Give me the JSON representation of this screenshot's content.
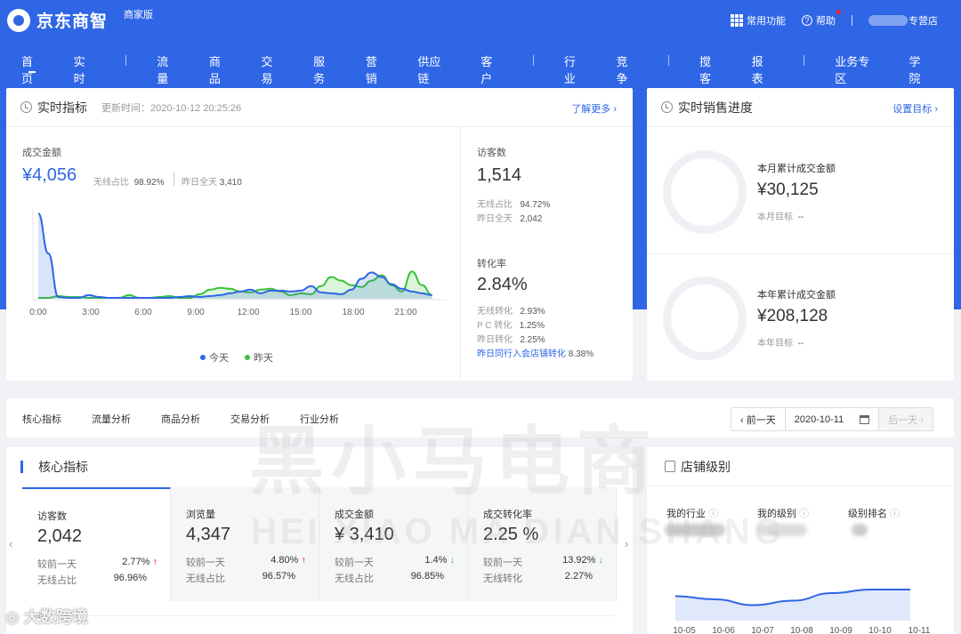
{
  "app": {
    "title": "京东商智",
    "edition": "商家版"
  },
  "topbar": {
    "common_functions": "常用功能",
    "help": "帮助",
    "shop_suffix": "专营店"
  },
  "nav": {
    "tabs": [
      "首页",
      "实时",
      "流量",
      "商品",
      "交易",
      "服务",
      "营销",
      "供应链",
      "客户",
      "行业",
      "竞争",
      "搅客",
      "报表",
      "业务专区",
      "学院"
    ],
    "active": "首页"
  },
  "realtime": {
    "title": "实时指标",
    "update_time": "更新时间：2020-10-12 20:25:26",
    "more_link": "了解更多 ›",
    "gmv_label": "成交金额",
    "gmv_value": "¥4,056",
    "wireless_ratio_label": "无线占比",
    "wireless_ratio": "98.92%",
    "yesterday_label": "昨日全天",
    "yesterday_value": "3,410",
    "visitors_label": "访客数",
    "visitors_value": "1,514",
    "visitors_wireless_label": "无线占比",
    "visitors_wireless": "94.72%",
    "visitors_yesterday_label": "昨日全天",
    "visitors_yesterday": "2,042",
    "conversion_label": "转化率",
    "conversion_value": "2.84%",
    "conv_wireless_label": "无线转化",
    "conv_wireless": "2.93%",
    "conv_pc_label": "P C 转化",
    "conv_pc": "1.25%",
    "conv_yesterday_label": "昨日转化",
    "conv_yesterday": "2.25%",
    "peer_label": "昨日同行入会店铺转化",
    "peer_value": "8.38%",
    "chart_data": {
      "type": "area",
      "x_ticks": [
        "0:00",
        "3:00",
        "6:00",
        "9:00",
        "12:00",
        "15:00",
        "18:00",
        "21:00"
      ],
      "series": [
        {
          "name": "今天",
          "color": "#2f66e6",
          "values": [
            9.4,
            5.0,
            0.2,
            0.1,
            0.1,
            0.4,
            0.2,
            0.1,
            0.1,
            0.1,
            0.1,
            0.1,
            0.1,
            0.1,
            0.2,
            0.3,
            0.2,
            0.3,
            0.4,
            0.6,
            0.8,
            1.0,
            0.6,
            0.9,
            0.9,
            0.8,
            0.9,
            1.4,
            0.7,
            0.6,
            0.5,
            1.0,
            2.2,
            2.9,
            2.4,
            1.6,
            1.1,
            0.8,
            0.6,
            0.4
          ]
        },
        {
          "name": "昨天",
          "color": "#3ac23a",
          "values": [
            0.1,
            0.1,
            0.3,
            0.2,
            0.2,
            0.1,
            0.1,
            0.1,
            0.1,
            0.4,
            0.1,
            0.1,
            0.2,
            0.3,
            0.1,
            0.1,
            0.5,
            1.0,
            1.2,
            1.1,
            0.8,
            0.7,
            1.0,
            1.1,
            0.8,
            0.4,
            0.6,
            0.5,
            1.4,
            2.4,
            2.0,
            1.5,
            1.3,
            2.0,
            2.6,
            1.5,
            0.8,
            3.0,
            1.5,
            0.4
          ]
        }
      ]
    }
  },
  "sales_progress": {
    "title": "实时销售进度",
    "set_target": "设置目标 ›",
    "month_label": "本月累计成交金额",
    "month_value": "¥30,125",
    "month_target_label": "本月目标",
    "month_target": "--",
    "year_label": "本年累计成交金额",
    "year_value": "¥208,128",
    "year_target_label": "本年目标",
    "year_target": "--"
  },
  "subnav": {
    "tabs": [
      "核心指标",
      "流量分析",
      "商品分析",
      "交易分析",
      "行业分析"
    ],
    "prev_day": "‹ 前一天",
    "date": "2020-10-11",
    "next_day": "后一天 ›"
  },
  "core": {
    "title": "核心指标",
    "axis_label": "4k",
    "kpis": [
      {
        "label": "访客数",
        "value": "2,042",
        "cmp_label": "较前一天",
        "cmp_value": "2.77%",
        "trend": "up",
        "sub_label": "无线占比",
        "sub_value": "96.96%"
      },
      {
        "label": "浏览量",
        "value": "4,347",
        "cmp_label": "较前一天",
        "cmp_value": "4.80%",
        "trend": "up",
        "sub_label": "无线占比",
        "sub_value": "96.57%"
      },
      {
        "label": "成交金额",
        "value": "¥ 3,410",
        "cmp_label": "较前一天",
        "cmp_value": "1.4%",
        "trend": "down",
        "sub_label": "无线占比",
        "sub_value": "96.85%"
      },
      {
        "label": "成交转化率",
        "value": "2.25 %",
        "cmp_label": "较前一天",
        "cmp_value": "13.92%",
        "trend": "down",
        "sub_label": "无线转化",
        "sub_value": "2.27%"
      }
    ]
  },
  "shop_level": {
    "title": "店铺级别",
    "col1": "我的行业",
    "col2": "我的级别",
    "col3": "级别排名",
    "chart_data": {
      "type": "area",
      "x_ticks": [
        "10-05",
        "10-06",
        "10-07",
        "10-08",
        "10-09",
        "10-10",
        "10-11"
      ],
      "series": [
        {
          "color": "#2f66e6",
          "values": [
            0.55,
            0.48,
            0.35,
            0.45,
            0.62,
            0.7,
            0.7
          ]
        }
      ]
    }
  },
  "watermark": {
    "cn": "黑小马电商",
    "en": "HEI XIAO MA DIAN SHANG",
    "bottom": "大数跨境"
  },
  "icons": {
    "arrow_up": "↑",
    "arrow_down": "↓"
  }
}
